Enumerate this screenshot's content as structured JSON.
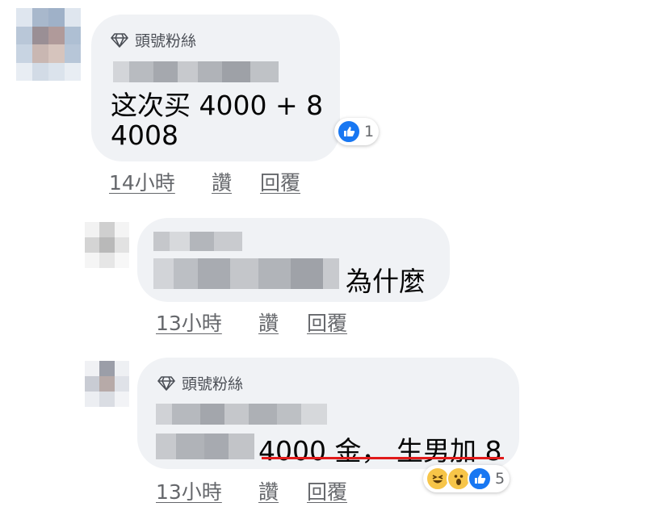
{
  "comments": [
    {
      "badge": "頭號粉絲",
      "lines": [
        "这次买 4000 + 8",
        "4008"
      ],
      "reaction_count": "1",
      "time": "14小時",
      "like": "讚",
      "reply": "回覆"
    },
    {
      "text": "為什麼",
      "time": "13小時",
      "like": "讚",
      "reply": "回覆"
    },
    {
      "badge": "頭號粉絲",
      "text": "4000 金， 生男加 8",
      "reaction_count": "5",
      "time": "13小時",
      "like": "讚",
      "reply": "回覆"
    }
  ],
  "colors": {
    "like_blue": "#1877f2",
    "haha_yellow": "#f7c548",
    "highlight_red": "#e11a1a"
  }
}
